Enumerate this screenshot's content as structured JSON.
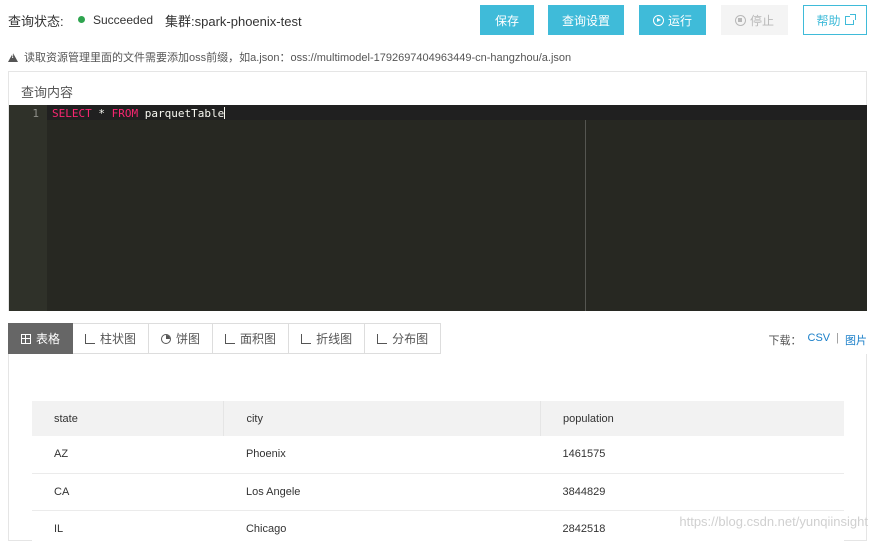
{
  "header": {
    "status_label": "查询状态:",
    "status_value": "Succeeded",
    "status_color": "#2ea44f",
    "cluster": "集群:spark-phoenix-test"
  },
  "toolbar": {
    "save_label": "保存",
    "settings_label": "查询设置",
    "run_label": "运行",
    "stop_label": "停止",
    "help_label": "帮助",
    "accent_color": "#3fbbd9"
  },
  "notice": {
    "text": "读取资源管理里面的文件需要添加oss前缀，如a.json：oss://multimodel-1792697404963449-cn-hangzhou/a.json",
    "icon": "warning-icon"
  },
  "query": {
    "title": "查询内容",
    "line_number": "1",
    "kw_select": "SELECT",
    "star": " * ",
    "kw_from": "FROM",
    "table": " parquetTable"
  },
  "tabs": [
    {
      "label": "表格",
      "icon": "table-icon",
      "active": true
    },
    {
      "label": "柱状图",
      "icon": "bar-chart-icon",
      "active": false
    },
    {
      "label": "饼图",
      "icon": "pie-chart-icon",
      "active": false
    },
    {
      "label": "面积图",
      "icon": "area-chart-icon",
      "active": false
    },
    {
      "label": "折线图",
      "icon": "line-chart-icon",
      "active": false
    },
    {
      "label": "分布图",
      "icon": "scatter-chart-icon",
      "active": false
    }
  ],
  "download": {
    "label": "下载：",
    "csv": "CSV",
    "separator": "|",
    "image": "图片"
  },
  "result_table": {
    "columns": [
      "state",
      "city",
      "population"
    ],
    "rows": [
      [
        "AZ",
        "Phoenix",
        "1461575"
      ],
      [
        "CA",
        "Los Angele",
        "3844829"
      ],
      [
        "IL",
        "Chicago",
        "2842518"
      ]
    ]
  },
  "watermark": "https://blog.csdn.net/yunqiinsight"
}
